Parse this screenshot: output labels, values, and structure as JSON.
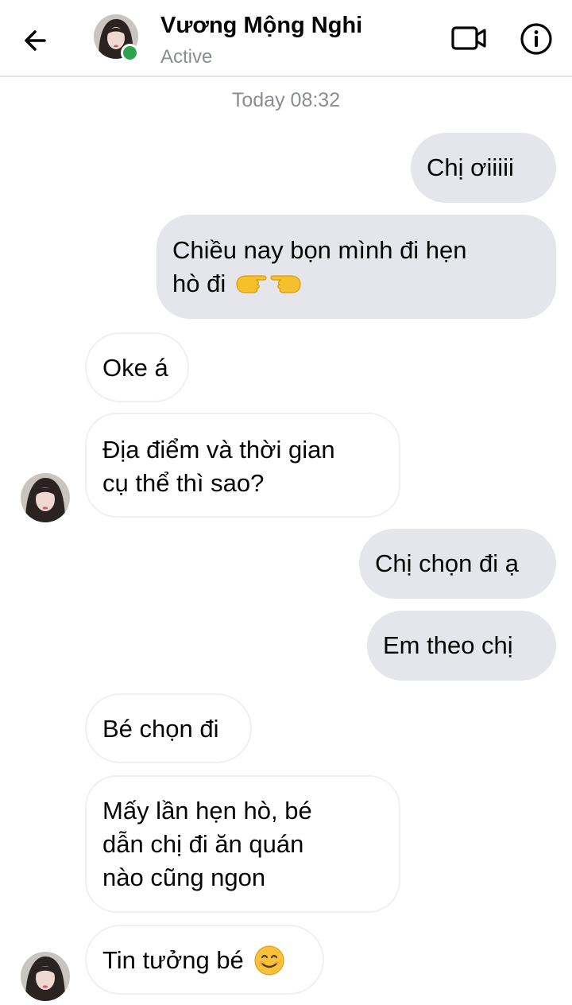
{
  "header": {
    "name": "Vương Mộng Nghi",
    "status": "Active"
  },
  "timestamp": "Today 08:32",
  "messages": {
    "m1": "Chị ơiiiii",
    "m2_line1": "Chiều nay bọn mình đi hẹn",
    "m2_line2": "hò đi",
    "m3": "Oke á",
    "m4_line1": "Địa điểm và thời gian",
    "m4_line2": "cụ thể thì sao?",
    "m5": "Chị chọn đi ạ",
    "m6": "Em theo chị",
    "m7": "Bé chọn đi",
    "m8_line1": "Mấy lần hẹn hò, bé",
    "m8_line2": "dẫn chị đi ăn quán",
    "m8_line3": "nào cũng ngon",
    "m9": "Tin tưởng bé"
  },
  "icons": {
    "back": "arrow-left-icon",
    "video": "video-camera-icon",
    "info": "info-icon",
    "pointing_hands": "pointing-hands-emoji",
    "smile": "smiling-face-emoji"
  },
  "colors": {
    "online": "#31a24c",
    "outgoing_bubble": "#e4e6eb",
    "incoming_border": "#eef0f2"
  }
}
